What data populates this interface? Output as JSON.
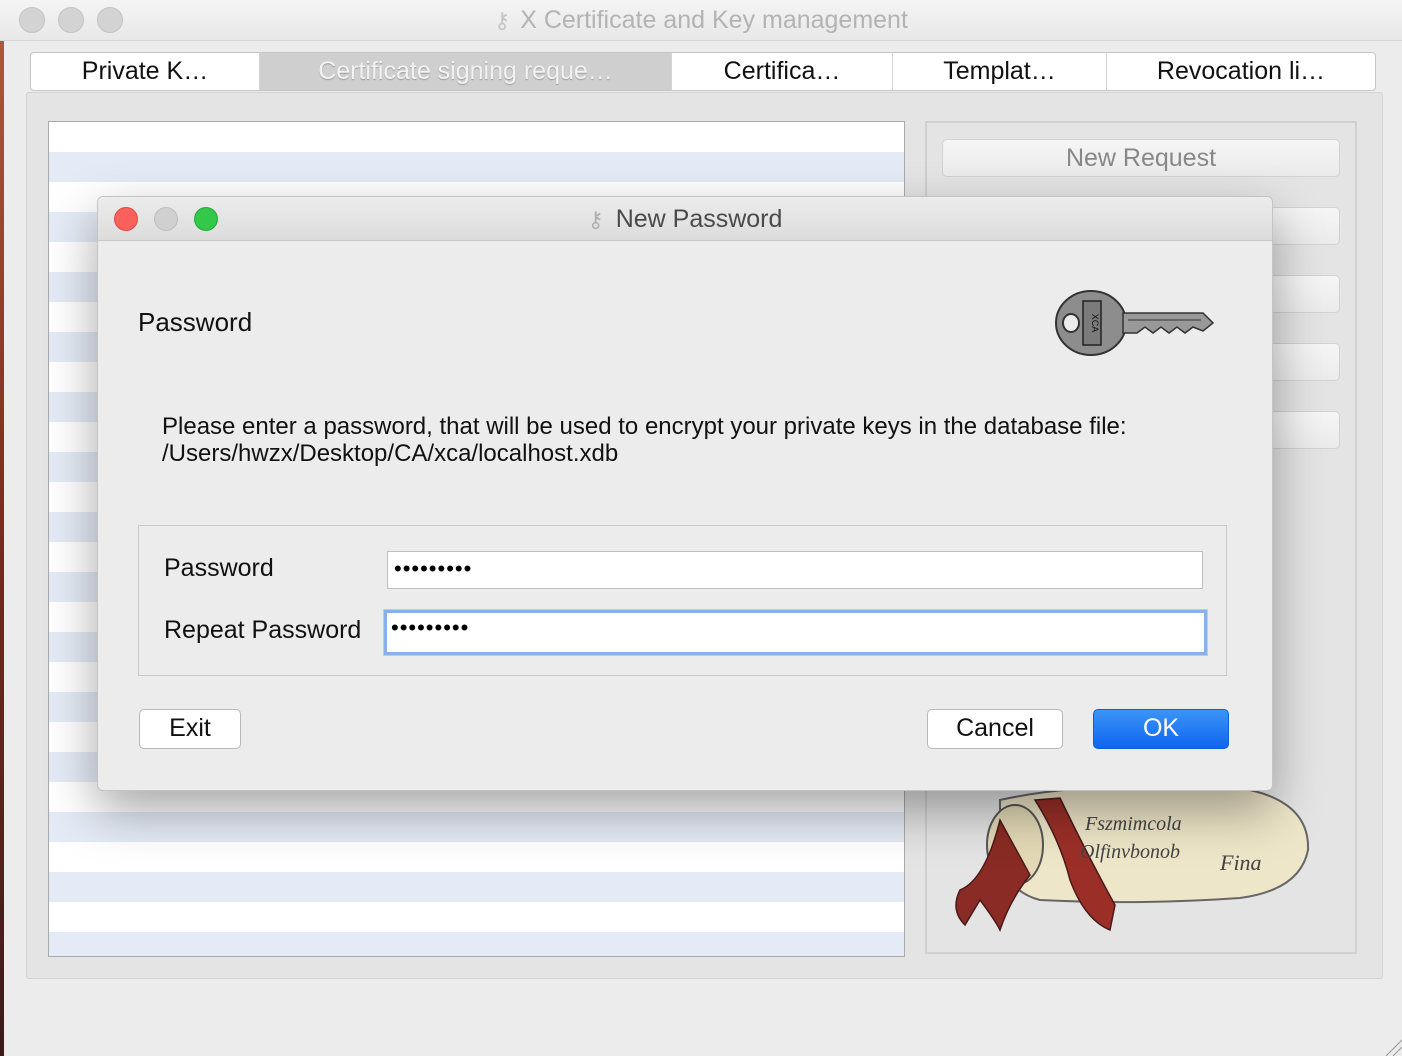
{
  "window": {
    "title": "X Certificate and Key management",
    "title_icon": "key-icon"
  },
  "tabs": [
    {
      "label": "Private K…",
      "selected": false
    },
    {
      "label": "Certificate signing reque…",
      "selected": true
    },
    {
      "label": "Certifica…",
      "selected": false
    },
    {
      "label": "Templat…",
      "selected": false
    },
    {
      "label": "Revocation li…",
      "selected": false
    }
  ],
  "side_buttons": {
    "new_request": "New Request"
  },
  "dialog": {
    "title": "New Password",
    "title_icon": "key-icon",
    "heading": "Password",
    "message_line1": "Please enter a password, that will be used to encrypt your private keys in the database file:",
    "message_line2": "/Users/hwzx/Desktop/CA/xca/localhost.xdb",
    "password_label": "Password",
    "password_value": "•••••••••",
    "repeat_label": "Repeat Password",
    "repeat_value": "•••••••••",
    "exit_label": "Exit",
    "cancel_label": "Cancel",
    "ok_label": "OK"
  },
  "colors": {
    "accent": "#1a73f0",
    "focus_ring": "#8ab0ea",
    "close": "#fc605c",
    "zoom": "#34c84a"
  }
}
